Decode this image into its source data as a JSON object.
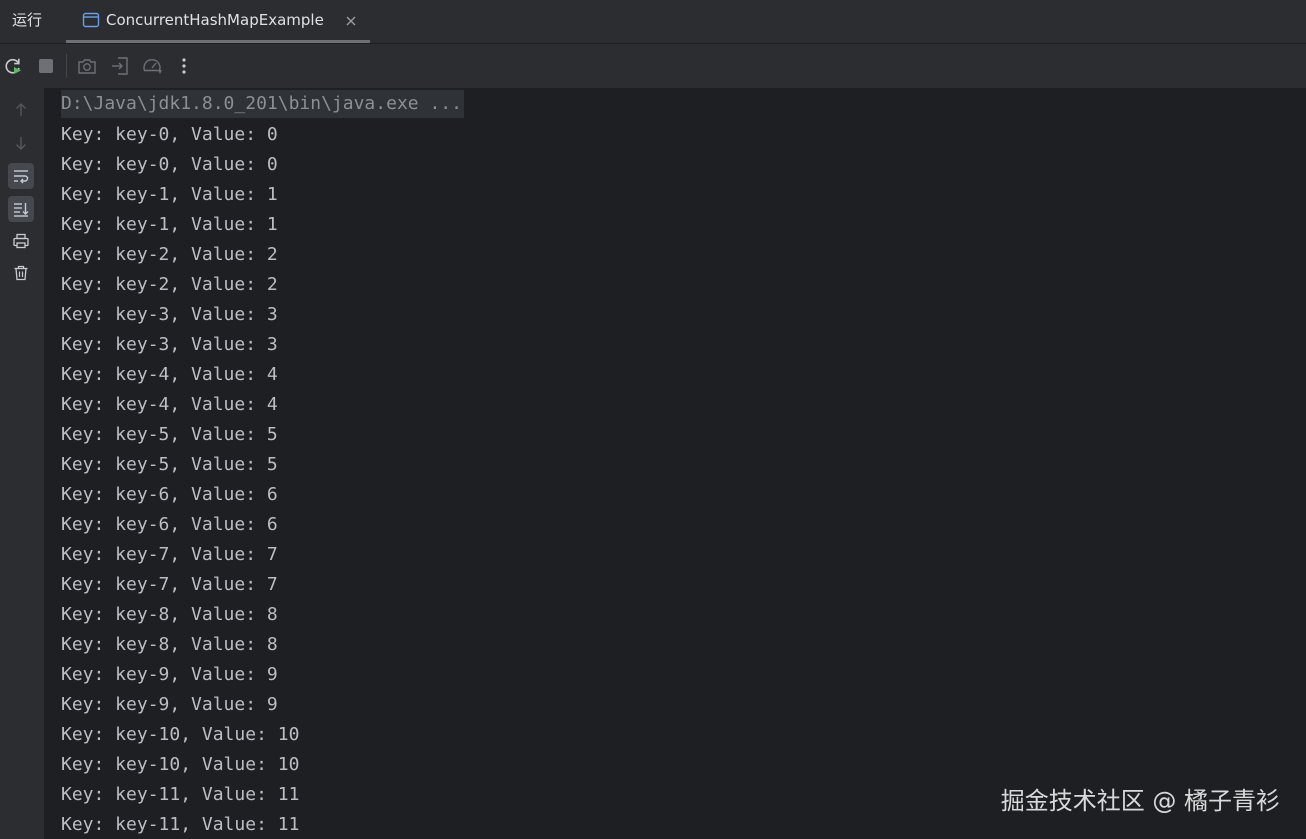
{
  "header": {
    "run_label": "运行",
    "tab": {
      "title": "ConcurrentHashMapExample",
      "icon": "console-window-icon",
      "close_icon": "close-icon"
    }
  },
  "toolbar": {
    "buttons": [
      {
        "name": "rerun-button",
        "icon": "rerun-icon"
      },
      {
        "name": "stop-button",
        "icon": "stop-icon"
      },
      {
        "name": "screenshot-button",
        "icon": "camera-icon"
      },
      {
        "name": "restore-layout-button",
        "icon": "import-icon"
      },
      {
        "name": "profiler-button",
        "icon": "gauge-icon"
      },
      {
        "name": "more-options-button",
        "icon": "more-vertical-icon"
      }
    ]
  },
  "gutter": {
    "buttons": [
      {
        "name": "scroll-up-button",
        "icon": "arrow-up-icon"
      },
      {
        "name": "scroll-down-button",
        "icon": "arrow-down-icon"
      },
      {
        "name": "soft-wrap-button",
        "icon": "soft-wrap-icon",
        "active": true
      },
      {
        "name": "scroll-to-end-button",
        "icon": "scroll-to-end-icon",
        "active": true
      },
      {
        "name": "print-button",
        "icon": "printer-icon"
      },
      {
        "name": "clear-all-button",
        "icon": "trash-icon"
      }
    ]
  },
  "console": {
    "command": "D:\\Java\\jdk1.8.0_201\\bin\\java.exe ...",
    "lines": [
      "Key: key-0, Value: 0",
      "Key: key-0, Value: 0",
      "Key: key-1, Value: 1",
      "Key: key-1, Value: 1",
      "Key: key-2, Value: 2",
      "Key: key-2, Value: 2",
      "Key: key-3, Value: 3",
      "Key: key-3, Value: 3",
      "Key: key-4, Value: 4",
      "Key: key-4, Value: 4",
      "Key: key-5, Value: 5",
      "Key: key-5, Value: 5",
      "Key: key-6, Value: 6",
      "Key: key-6, Value: 6",
      "Key: key-7, Value: 7",
      "Key: key-7, Value: 7",
      "Key: key-8, Value: 8",
      "Key: key-8, Value: 8",
      "Key: key-9, Value: 9",
      "Key: key-9, Value: 9",
      "Key: key-10, Value: 10",
      "Key: key-10, Value: 10",
      "Key: key-11, Value: 11",
      "Key: key-11, Value: 11"
    ]
  },
  "watermark": "掘金技术社区 @ 橘子青衫",
  "colors": {
    "background": "#1e1f22",
    "panel": "#2b2d30",
    "text": "#bcbec4",
    "command_text": "#8c8f95",
    "rerun_accent": "#5fb865"
  }
}
